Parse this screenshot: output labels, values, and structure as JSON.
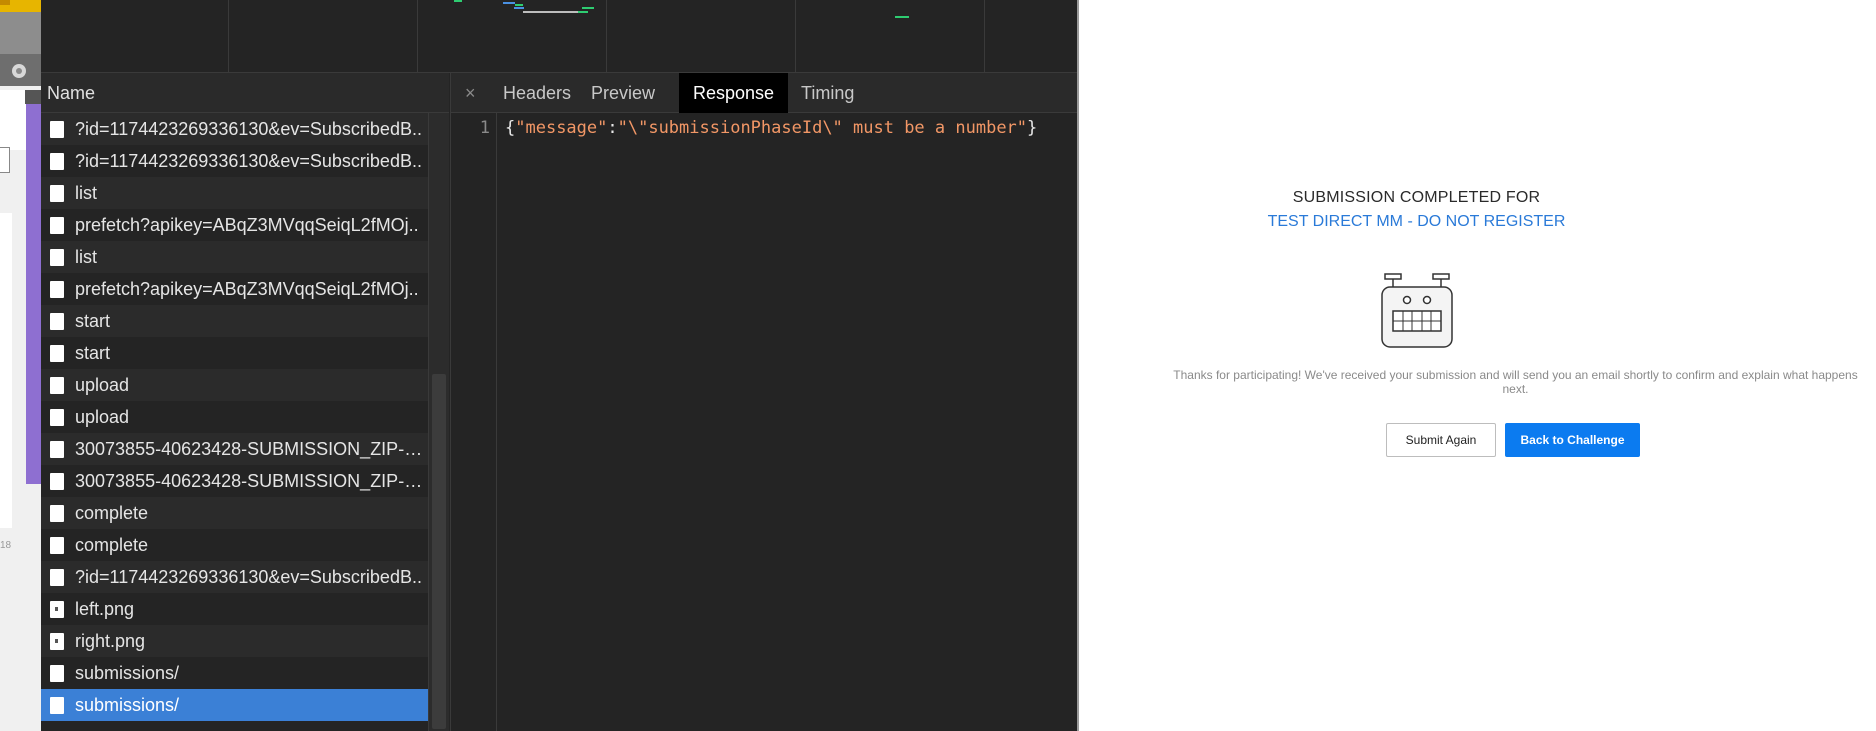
{
  "devtools": {
    "name_header": "Name",
    "close_glyph": "×",
    "tabs": [
      {
        "label": "Headers"
      },
      {
        "label": "Preview"
      },
      {
        "label": "Response"
      },
      {
        "label": "Timing"
      }
    ],
    "active_tab": "Response",
    "requests": [
      {
        "label": "?id=1174423269336130&ev=SubscribedB..",
        "icon": "file-icon"
      },
      {
        "label": "?id=1174423269336130&ev=SubscribedB..",
        "icon": "file-icon"
      },
      {
        "label": "list",
        "icon": "file-icon"
      },
      {
        "label": "prefetch?apikey=ABqZ3MVqqSeiqL2fMOj..",
        "icon": "file-icon"
      },
      {
        "label": "list",
        "icon": "file-icon"
      },
      {
        "label": "prefetch?apikey=ABqZ3MVqqSeiqL2fMOj..",
        "icon": "file-icon"
      },
      {
        "label": "start",
        "icon": "file-icon"
      },
      {
        "label": "start",
        "icon": "file-icon"
      },
      {
        "label": "upload",
        "icon": "file-icon"
      },
      {
        "label": "upload",
        "icon": "file-icon"
      },
      {
        "label": "30073855-40623428-SUBMISSION_ZIP-1..",
        "icon": "file-icon"
      },
      {
        "label": "30073855-40623428-SUBMISSION_ZIP-1..",
        "icon": "file-icon"
      },
      {
        "label": "complete",
        "icon": "file-icon"
      },
      {
        "label": "complete",
        "icon": "file-icon"
      },
      {
        "label": "?id=1174423269336130&ev=SubscribedB..",
        "icon": "file-icon"
      },
      {
        "label": "left.png",
        "icon": "image-icon"
      },
      {
        "label": "right.png",
        "icon": "image-icon"
      },
      {
        "label": "submissions/",
        "icon": "file-icon"
      },
      {
        "label": "submissions/",
        "icon": "file-icon",
        "selected": true
      }
    ],
    "response": {
      "line_number": "1",
      "open_brace": "{",
      "key": "\"message\"",
      "colon": ":",
      "value": "\"\\\"submissionPhaseId\\\" must be a number\"",
      "close_brace": "}"
    }
  },
  "left_strip": {
    "number_fragment": "18"
  },
  "page": {
    "heading": "SUBMISSION COMPLETED FOR",
    "challenge_name": "TEST DIRECT MM - DO NOT REGISTER",
    "message": "Thanks for participating! We've received your submission and will send you an email shortly to confirm and explain what happens next.",
    "submit_again_label": "Submit Again",
    "back_label": "Back to Challenge",
    "robot_icon": "robot-icon",
    "link_color": "#2a7ad8",
    "primary_color": "#0b7bf0"
  }
}
